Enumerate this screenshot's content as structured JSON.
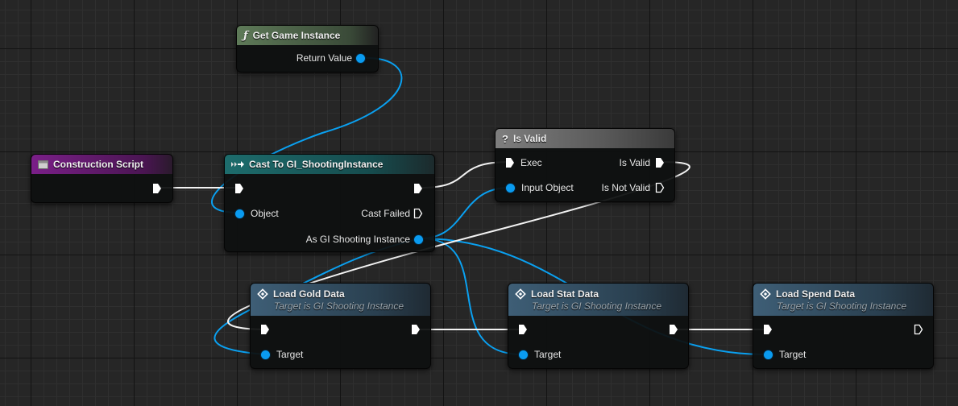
{
  "colors": {
    "exec_wire": "#f2f2f2",
    "object_wire": "#0aa0f0",
    "pure_function_header": "#5e7a58",
    "event_header": "#6f1f7a",
    "cast_header": "#1d6c6c",
    "macro_header": "#6e6e6e",
    "function_header": "#3e5e76"
  },
  "nodes": {
    "get_game_instance": {
      "title": "Get Game Instance",
      "icon": "function-icon",
      "return_value": "Return Value"
    },
    "construction_script": {
      "title": "Construction Script",
      "icon": "event-icon"
    },
    "cast": {
      "title": "Cast To GI_ShootingInstance",
      "icon": "cast-icon",
      "object": "Object",
      "cast_failed": "Cast Failed",
      "as_instance": "As GI Shooting Instance"
    },
    "is_valid": {
      "title": "Is Valid",
      "icon": "question-icon",
      "exec": "Exec",
      "input_object": "Input Object",
      "is_valid": "Is Valid",
      "is_not_valid": "Is Not Valid"
    },
    "load_gold": {
      "title": "Load Gold Data",
      "subtitle": "Target is GI Shooting Instance",
      "icon": "function-icon",
      "target": "Target"
    },
    "load_stat": {
      "title": "Load Stat Data",
      "subtitle": "Target is GI Shooting Instance",
      "icon": "function-icon",
      "target": "Target"
    },
    "load_spend": {
      "title": "Load Spend Data",
      "subtitle": "Target is GI Shooting Instance",
      "icon": "function-icon",
      "target": "Target"
    }
  }
}
